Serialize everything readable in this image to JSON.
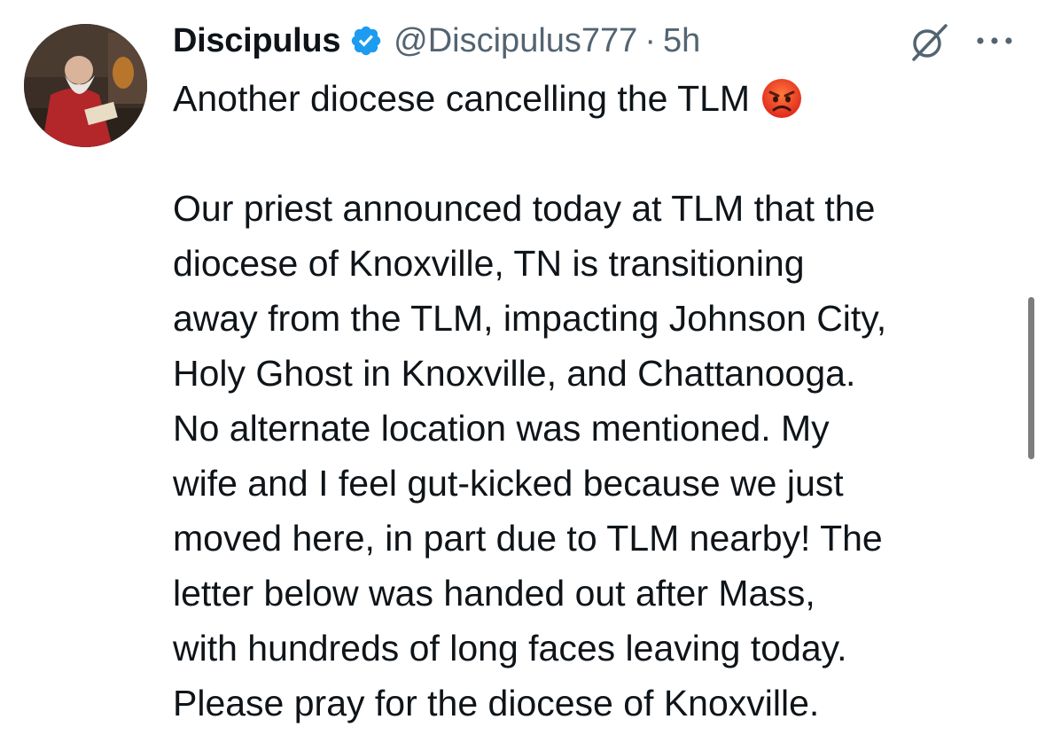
{
  "author": {
    "display_name": "Discipulus",
    "handle": "@Discipulus777",
    "separator": "·",
    "time": "5h",
    "verified": true,
    "avatar_icon": "avatar-portrait"
  },
  "tweet": {
    "first_line": "Another diocese cancelling the TLM",
    "emoji": "angry-face-emoji",
    "body_lines": [
      "Our priest announced today at TLM that the",
      "diocese of Knoxville, TN is transitioning",
      "away from the TLM, impacting Johnson City,",
      "Holy Ghost in Knoxville, and Chattanooga.",
      "No alternate location was mentioned. My",
      "wife and I feel gut-kicked because we just",
      "moved here, in part due to TLM nearby!  The",
      "letter below was handed out after Mass,",
      "with hundreds of long faces leaving today.",
      "Please pray for the diocese of Knoxville."
    ]
  },
  "icons": {
    "verified": "verified-badge-icon",
    "grok": "grok-icon",
    "more": "more-options-icon"
  },
  "colors": {
    "text": "#0f1419",
    "secondary": "#536471",
    "verified_blue": "#1d9bf0",
    "scrollbar": "#7d7d7d"
  }
}
